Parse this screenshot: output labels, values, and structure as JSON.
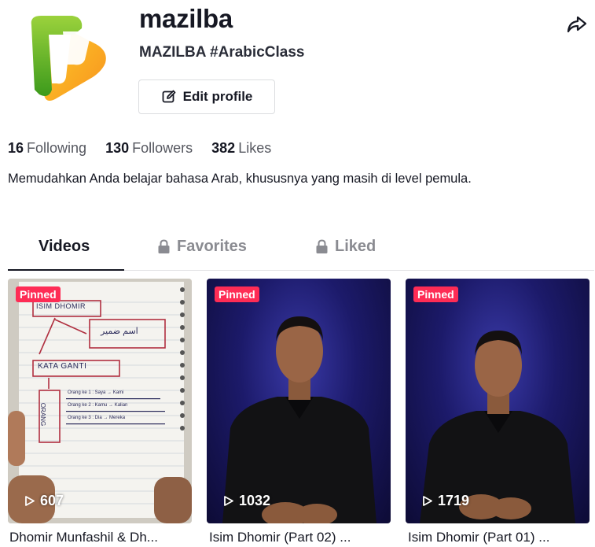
{
  "profile": {
    "username": "mazilba",
    "nickname": "MAZILBA #ArabicClass",
    "edit_label": "Edit profile",
    "bio": "Memudahkan Anda belajar bahasa Arab, khususnya yang masih di level pemula."
  },
  "stats": {
    "following": {
      "count": "16",
      "label": "Following"
    },
    "followers": {
      "count": "130",
      "label": "Followers"
    },
    "likes": {
      "count": "382",
      "label": "Likes"
    }
  },
  "tabs": [
    {
      "label": "Videos",
      "active": true,
      "locked": false
    },
    {
      "label": "Favorites",
      "active": false,
      "locked": true
    },
    {
      "label": "Liked",
      "active": false,
      "locked": true
    }
  ],
  "videos": [
    {
      "badge": "Pinned",
      "views": "607",
      "caption": "Dhomir Munfashil & Dh...",
      "notes": {
        "heading": "ISIM DHOMIR",
        "arabic": "اسم ضمير",
        "kata": "KATA GANTI",
        "orang": "ORANG",
        "line1": "Orang ke 1 : Saya → Kami",
        "line2": "Orang ke 2 : Kamu → Kalian",
        "line3": "Orang ke 3 : Dia → Mereka"
      }
    },
    {
      "badge": "Pinned",
      "views": "1032",
      "caption": "Isim Dhomir (Part 02) ..."
    },
    {
      "badge": "Pinned",
      "views": "1719",
      "caption": "Isim Dhomir (Part 01) ..."
    }
  ],
  "colors": {
    "pinned": "#fe2c55",
    "text": "#161823",
    "muted": "#8a8b91"
  },
  "icons": [
    "edit-icon",
    "share-icon",
    "lock-icon",
    "play-icon"
  ]
}
